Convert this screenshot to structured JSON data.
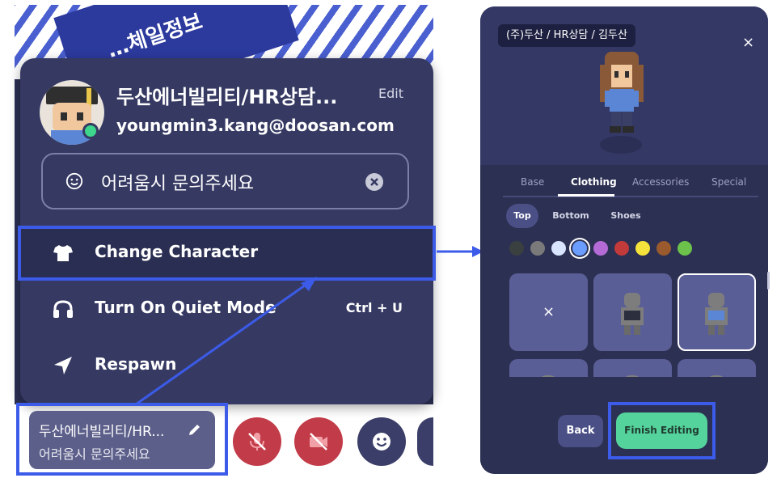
{
  "banner": {
    "sign_text": "…체일정보"
  },
  "profile": {
    "name": "두산에너빌리티/HR상담...",
    "edit_label": "Edit",
    "email": "youngmin3.kang@doosan.com",
    "status_text": "어려움시 문의주세요"
  },
  "menu": {
    "items": [
      {
        "label": "Change Character",
        "icon": "tshirt-icon",
        "shortcut": ""
      },
      {
        "label": "Turn On Quiet Mode",
        "icon": "headphones-icon",
        "shortcut": "Ctrl + U"
      },
      {
        "label": "Respawn",
        "icon": "navigation-arrow-icon",
        "shortcut": ""
      }
    ]
  },
  "status_chip": {
    "name": "두산에너빌리티/HR...",
    "status": "어려움시 문의주세요"
  },
  "controls": {
    "buttons": [
      "mic-muted-icon",
      "camera-off-icon",
      "emoji-icon",
      "more-icon"
    ],
    "muted_color": "#c23b48"
  },
  "editor": {
    "name_tag": "(주)두산 / HR상담 / 김두산",
    "close_label": "×",
    "tabs": [
      "Base",
      "Clothing",
      "Accessories",
      "Special"
    ],
    "active_tab": "Clothing",
    "sub_tabs": [
      "Top",
      "Bottom",
      "Shoes"
    ],
    "active_sub_tab": "Top",
    "colors": [
      "#3a4040",
      "#7a7a7a",
      "#d9e4ff",
      "#6b9cff",
      "#b56bd6",
      "#c33a3a",
      "#f5e23a",
      "#9a5a2e",
      "#6cc24a"
    ],
    "selected_color_index": 3,
    "none_card_label": "×",
    "back_label": "Back",
    "finish_label": "Finish Editing"
  },
  "accent": "#3b5be8"
}
